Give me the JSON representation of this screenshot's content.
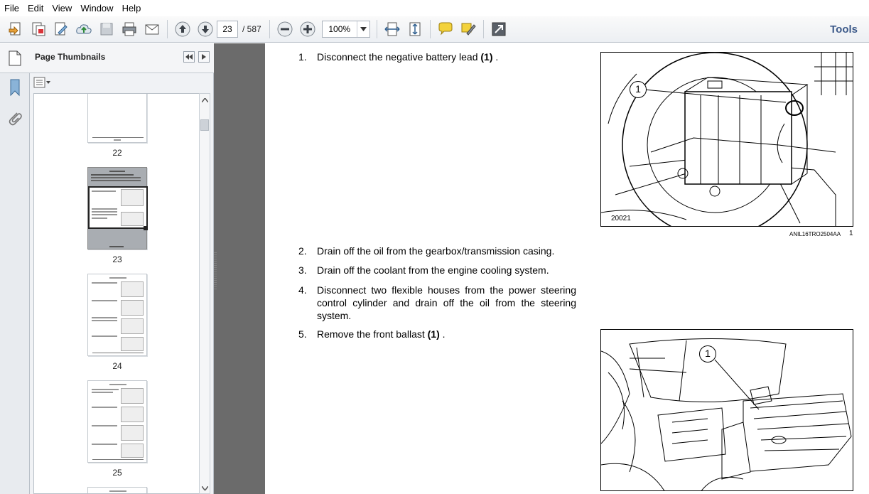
{
  "menu": [
    "File",
    "Edit",
    "View",
    "Window",
    "Help"
  ],
  "toolbar": {
    "current_page": "23",
    "total_pages": "/ 587",
    "zoom": "100%",
    "tools_label": "Tools"
  },
  "panel": {
    "title": "Page Thumbnails",
    "thumbnails": [
      {
        "label": "22"
      },
      {
        "label": "23",
        "selected": true
      },
      {
        "label": "24"
      },
      {
        "label": "25"
      }
    ]
  },
  "document": {
    "steps": [
      {
        "num": "1.",
        "text": "Disconnect the negative battery lead ",
        "bold": "(1)",
        "tail": " ."
      },
      {
        "num": "2.",
        "text": "Drain off the oil from the gearbox/transmission casing."
      },
      {
        "num": "3.",
        "text": "Drain off the coolant from the engine cooling system."
      },
      {
        "num": "4.",
        "text": "Disconnect two flexible houses from the power steering control cylinder and drain off the oil from the steering system."
      },
      {
        "num": "5.",
        "text": "Remove the front ballast ",
        "bold": "(1)",
        "tail": " ."
      }
    ],
    "figure1": {
      "callout": "1",
      "code": "20021",
      "caption": "ANIL16TRO2504AA",
      "index": "1"
    },
    "figure2": {
      "callout": "1"
    }
  }
}
